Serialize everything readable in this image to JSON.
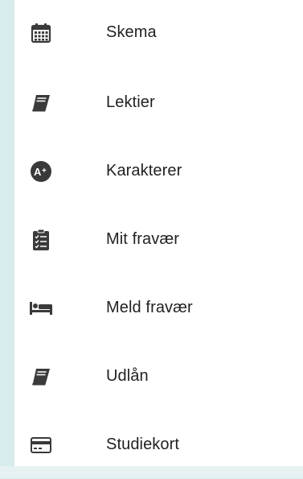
{
  "colors": {
    "icon": "#3a3a3a",
    "text": "#222222",
    "drawer_bg": "#ffffff",
    "side_bg": "#d7ecec"
  },
  "menu": {
    "items": [
      {
        "label": "Skema",
        "icon": "calendar-icon"
      },
      {
        "label": "Lektier",
        "icon": "book-icon"
      },
      {
        "label": "Karakterer",
        "icon": "grade-a-plus-icon"
      },
      {
        "label": "Mit fravær",
        "icon": "clipboard-checklist-icon"
      },
      {
        "label": "Meld fravær",
        "icon": "bed-icon"
      },
      {
        "label": "Udlån",
        "icon": "book-icon"
      },
      {
        "label": "Studiekort",
        "icon": "card-icon"
      }
    ]
  }
}
